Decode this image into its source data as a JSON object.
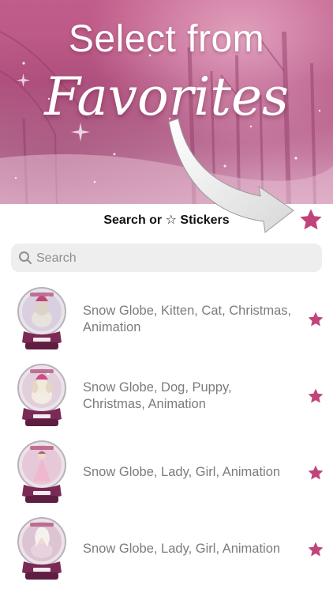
{
  "banner": {
    "headline_line1": "Select from",
    "headline_line2": "Favorites"
  },
  "toolbar": {
    "label": "Search or ☆  Stickers",
    "favorite_icon": "star-icon"
  },
  "search": {
    "placeholder": "Search",
    "value": ""
  },
  "stickers": [
    {
      "label": "Snow Globe, Kitten, Cat, Christmas, Animation",
      "favorite": true
    },
    {
      "label": "Snow Globe, Dog, Puppy, Christmas, Animation",
      "favorite": true
    },
    {
      "label": "Snow Globe, Lady, Girl, Animation",
      "favorite": true
    },
    {
      "label": "Snow Globe, Lady, Girl, Animation",
      "favorite": true
    }
  ],
  "colors": {
    "accent": "#c0447a",
    "banner": "#b65583",
    "globe_base": "#7a2a55"
  }
}
